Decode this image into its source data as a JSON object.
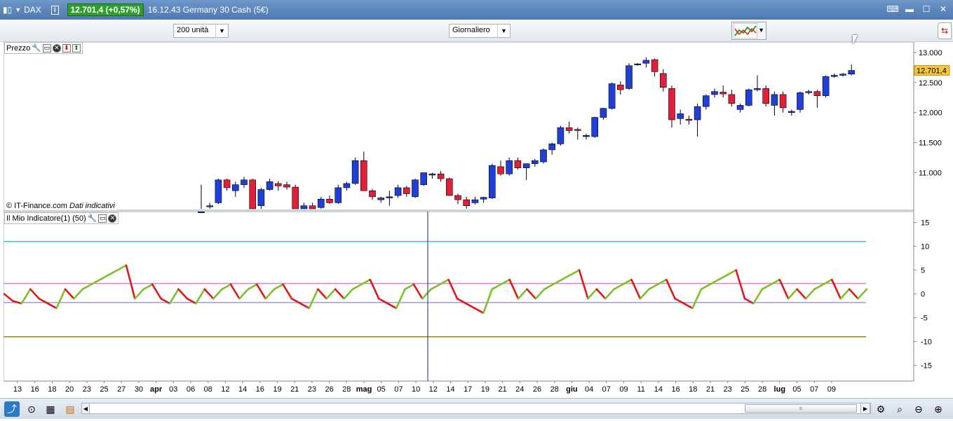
{
  "titlebar": {
    "symbol": "DAX",
    "info": "i",
    "price": "12.701,4 (+0,57%)",
    "time_and_name": "16.12.43 Germany 30 Cash (5€)"
  },
  "toolbar": {
    "units": "200 unità",
    "period": "Giornaliero"
  },
  "price_panel": {
    "label": "Prezzo",
    "current_price": "12.701,4",
    "y_ticks": [
      "13.000",
      "12.500",
      "12.000",
      "11.500",
      "11.000"
    ],
    "copyright": "© IT-Finance.com",
    "copyright_note": "Dati indicativi"
  },
  "indicator_panel": {
    "label": "Il Mio Indicatore(1) (50)",
    "y_ticks": [
      "15",
      "10",
      "5",
      "0",
      "-5",
      "-10",
      "-15"
    ]
  },
  "x_axis": {
    "labels": [
      "13",
      "16",
      "18",
      "20",
      "23",
      "25",
      "27",
      "30",
      "apr",
      "03",
      "06",
      "08",
      "12",
      "14",
      "16",
      "19",
      "21",
      "23",
      "26",
      "28",
      "mag",
      "05",
      "07",
      "10",
      "12",
      "14",
      "17",
      "19",
      "21",
      "24",
      "26",
      "28",
      "giu",
      "04",
      "07",
      "09",
      "11",
      "14",
      "16",
      "18",
      "21",
      "23",
      "25",
      "28",
      "lug",
      "05",
      "07",
      "09"
    ]
  },
  "colors": {
    "up": "#1f3fd8",
    "down": "#e0203a",
    "line_up": "#7cc12a",
    "line_down": "#e01818",
    "level_cyan": "#39c6d0",
    "level_pink": "#e27ad6",
    "level_lavender": "#9a9ae6",
    "level_olive": "#8f8a18",
    "cursor": "#1a2a6a"
  },
  "chart_data": [
    {
      "type": "candlestick",
      "y_unit": "points",
      "ylim": [
        10400,
        13150
      ],
      "candles": [
        {
          "o": 10350,
          "h": 10800,
          "l": 10300,
          "c": 10350
        },
        {
          "o": 10450,
          "h": 10500,
          "l": 10380,
          "c": 10450
        },
        {
          "o": 10500,
          "h": 10900,
          "l": 10480,
          "c": 10880
        },
        {
          "o": 10880,
          "h": 10900,
          "l": 10700,
          "c": 10750
        },
        {
          "o": 10700,
          "h": 10850,
          "l": 10600,
          "c": 10800
        },
        {
          "o": 10800,
          "h": 10930,
          "l": 10750,
          "c": 10880
        },
        {
          "o": 10880,
          "h": 10900,
          "l": 10350,
          "c": 10400
        },
        {
          "o": 10450,
          "h": 10750,
          "l": 10400,
          "c": 10720
        },
        {
          "o": 10720,
          "h": 10900,
          "l": 10700,
          "c": 10850
        },
        {
          "o": 10820,
          "h": 10860,
          "l": 10700,
          "c": 10780
        },
        {
          "o": 10800,
          "h": 10850,
          "l": 10720,
          "c": 10760
        },
        {
          "o": 10760,
          "h": 10800,
          "l": 10350,
          "c": 10380
        },
        {
          "o": 10400,
          "h": 10500,
          "l": 10350,
          "c": 10450
        },
        {
          "o": 10450,
          "h": 10500,
          "l": 10300,
          "c": 10400
        },
        {
          "o": 10420,
          "h": 10600,
          "l": 10400,
          "c": 10560
        },
        {
          "o": 10560,
          "h": 10620,
          "l": 10480,
          "c": 10500
        },
        {
          "o": 10500,
          "h": 10800,
          "l": 10480,
          "c": 10750
        },
        {
          "o": 10750,
          "h": 10850,
          "l": 10700,
          "c": 10820
        },
        {
          "o": 10820,
          "h": 11250,
          "l": 10800,
          "c": 11200
        },
        {
          "o": 11200,
          "h": 11350,
          "l": 10700,
          "c": 10700
        },
        {
          "o": 10700,
          "h": 10730,
          "l": 10550,
          "c": 10600
        },
        {
          "o": 10550,
          "h": 10600,
          "l": 10500,
          "c": 10580
        },
        {
          "o": 10580,
          "h": 10700,
          "l": 10450,
          "c": 10600
        },
        {
          "o": 10620,
          "h": 10800,
          "l": 10580,
          "c": 10750
        },
        {
          "o": 10750,
          "h": 10780,
          "l": 10600,
          "c": 10650
        },
        {
          "o": 10600,
          "h": 10900,
          "l": 10580,
          "c": 10880
        },
        {
          "o": 10800,
          "h": 11000,
          "l": 10780,
          "c": 11000
        },
        {
          "o": 10960,
          "h": 11000,
          "l": 10900,
          "c": 10980
        },
        {
          "o": 10980,
          "h": 11030,
          "l": 10850,
          "c": 10900
        },
        {
          "o": 10900,
          "h": 10920,
          "l": 10620,
          "c": 10620
        },
        {
          "o": 10620,
          "h": 10650,
          "l": 10480,
          "c": 10550
        },
        {
          "o": 10550,
          "h": 10600,
          "l": 10400,
          "c": 10450
        },
        {
          "o": 10500,
          "h": 10600,
          "l": 10470,
          "c": 10550
        },
        {
          "o": 10560,
          "h": 10600,
          "l": 10500,
          "c": 10590
        },
        {
          "o": 10580,
          "h": 11150,
          "l": 10560,
          "c": 11120
        },
        {
          "o": 11100,
          "h": 11200,
          "l": 10950,
          "c": 10980
        },
        {
          "o": 10980,
          "h": 11250,
          "l": 10950,
          "c": 11200
        },
        {
          "o": 11200,
          "h": 11250,
          "l": 11050,
          "c": 11080
        },
        {
          "o": 11080,
          "h": 11150,
          "l": 10880,
          "c": 11150
        },
        {
          "o": 11150,
          "h": 11230,
          "l": 11100,
          "c": 11200
        },
        {
          "o": 11180,
          "h": 11400,
          "l": 11150,
          "c": 11380
        },
        {
          "o": 11380,
          "h": 11500,
          "l": 11300,
          "c": 11480
        },
        {
          "o": 11480,
          "h": 11780,
          "l": 11450,
          "c": 11750
        },
        {
          "o": 11750,
          "h": 11850,
          "l": 11650,
          "c": 11700
        },
        {
          "o": 11720,
          "h": 11750,
          "l": 11550,
          "c": 11700
        },
        {
          "o": 11600,
          "h": 11650,
          "l": 11550,
          "c": 11620
        },
        {
          "o": 11600,
          "h": 11930,
          "l": 11580,
          "c": 11920
        },
        {
          "o": 11920,
          "h": 12080,
          "l": 11880,
          "c": 12070
        },
        {
          "o": 12070,
          "h": 12500,
          "l": 12050,
          "c": 12480
        },
        {
          "o": 12460,
          "h": 12520,
          "l": 12300,
          "c": 12380
        },
        {
          "o": 12400,
          "h": 12820,
          "l": 12380,
          "c": 12780
        },
        {
          "o": 12800,
          "h": 12820,
          "l": 12780,
          "c": 12810
        },
        {
          "o": 12820,
          "h": 12920,
          "l": 12750,
          "c": 12870
        },
        {
          "o": 12880,
          "h": 12900,
          "l": 12600,
          "c": 12680
        },
        {
          "o": 12650,
          "h": 12720,
          "l": 12350,
          "c": 12420
        },
        {
          "o": 12400,
          "h": 12450,
          "l": 11750,
          "c": 11880
        },
        {
          "o": 11900,
          "h": 12050,
          "l": 11800,
          "c": 11980
        },
        {
          "o": 11890,
          "h": 11950,
          "l": 11800,
          "c": 11870
        },
        {
          "o": 11880,
          "h": 12150,
          "l": 11600,
          "c": 12100
        },
        {
          "o": 12100,
          "h": 12300,
          "l": 12050,
          "c": 12280
        },
        {
          "o": 12300,
          "h": 12400,
          "l": 12250,
          "c": 12350
        },
        {
          "o": 12340,
          "h": 12450,
          "l": 12250,
          "c": 12310
        },
        {
          "o": 12300,
          "h": 12380,
          "l": 12100,
          "c": 12150
        },
        {
          "o": 12050,
          "h": 12150,
          "l": 12000,
          "c": 12120
        },
        {
          "o": 12120,
          "h": 12400,
          "l": 12100,
          "c": 12380
        },
        {
          "o": 12380,
          "h": 12620,
          "l": 12350,
          "c": 12400
        },
        {
          "o": 12400,
          "h": 12450,
          "l": 12100,
          "c": 12150
        },
        {
          "o": 12120,
          "h": 12350,
          "l": 11950,
          "c": 12300
        },
        {
          "o": 12300,
          "h": 12350,
          "l": 12000,
          "c": 12080
        },
        {
          "o": 12000,
          "h": 12050,
          "l": 11950,
          "c": 12020
        },
        {
          "o": 12050,
          "h": 12350,
          "l": 12000,
          "c": 12330
        },
        {
          "o": 12330,
          "h": 12380,
          "l": 12300,
          "c": 12350
        },
        {
          "o": 12350,
          "h": 12380,
          "l": 12080,
          "c": 12280
        },
        {
          "o": 12280,
          "h": 12620,
          "l": 12250,
          "c": 12600
        },
        {
          "o": 12600,
          "h": 12650,
          "l": 12580,
          "c": 12620
        },
        {
          "o": 12620,
          "h": 12660,
          "l": 12600,
          "c": 12640
        },
        {
          "o": 12640,
          "h": 12800,
          "l": 12620,
          "c": 12701
        }
      ]
    },
    {
      "type": "line",
      "ylim": [
        -18,
        17
      ],
      "levels": [
        11,
        2.2,
        -1.8,
        -9
      ],
      "values": [
        0,
        -1.5,
        -2,
        1,
        -1,
        -2,
        -3,
        1,
        -1,
        1,
        2,
        3,
        4,
        5,
        6,
        -1,
        1,
        2,
        -1,
        -2,
        1,
        -1,
        -2,
        1,
        -1,
        1,
        2,
        -1,
        1,
        2,
        -1,
        1,
        2,
        -1,
        -2,
        -3,
        1,
        -1,
        1,
        -1,
        1,
        2,
        3,
        -1,
        -2,
        -3,
        1,
        2,
        -1,
        1,
        2,
        3,
        -1,
        -2,
        -3,
        -4,
        1,
        2,
        3,
        -1,
        1,
        -1,
        1,
        2,
        3,
        4,
        5,
        -1,
        1,
        -1,
        1,
        2,
        3,
        -1,
        1,
        2,
        3,
        -1,
        -2,
        -3,
        1,
        2,
        3,
        4,
        5,
        -1,
        -2,
        1,
        2,
        3,
        -1,
        1,
        -1,
        1,
        2,
        3,
        -1,
        1,
        -1,
        1
      ],
      "cursor_index": 47
    }
  ]
}
